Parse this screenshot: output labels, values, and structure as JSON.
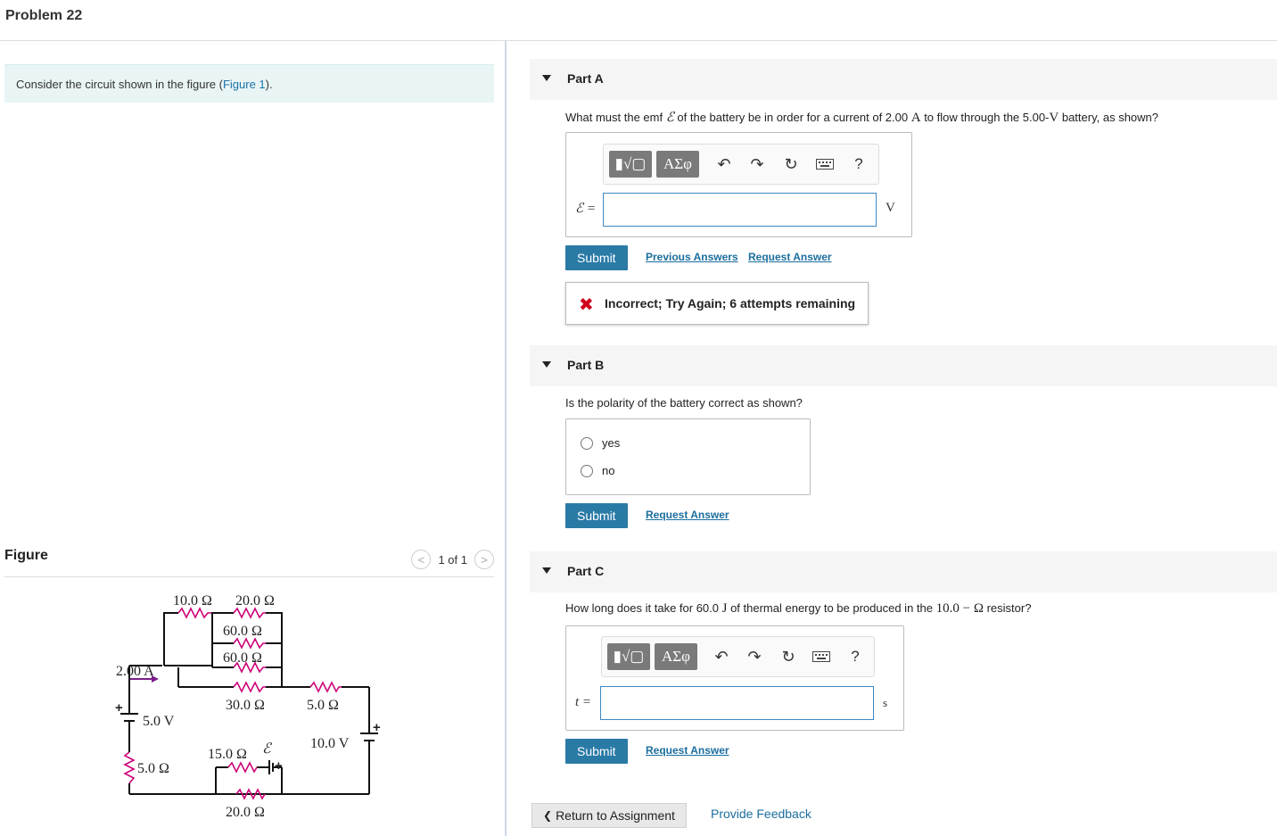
{
  "header": {
    "title": "Problem 22"
  },
  "intro": {
    "text_before": "Consider the circuit shown in the figure (",
    "figure_link": "Figure 1",
    "text_after": ")."
  },
  "figure_panel": {
    "label": "Figure",
    "pager_text": "1 of 1",
    "prev_glyph": "<",
    "next_glyph": ">",
    "circuit_labels": {
      "r10": "10.0 Ω",
      "r20top": "20.0 Ω",
      "r60a": "60.0 Ω",
      "r60b": "60.0 Ω",
      "current": "2.00 A",
      "r30": "30.0 Ω",
      "r5right": "5.0 Ω",
      "v5": "5.0 V",
      "v10": "10.0 V",
      "r15": "15.0 Ω",
      "emf": "ℰ",
      "r5left": "5.0 Ω",
      "r20bottom": "20.0 Ω",
      "plus": "+"
    }
  },
  "partA": {
    "title": "Part A",
    "q1": "What must the emf ",
    "q_emf": "ℰ",
    "q2": " of the battery be in order for a current of 2.00 ",
    "q_A": "A",
    "q3": " to flow through the 5.00-",
    "q_V": "V",
    "q4": " battery, as shown?",
    "toolbar": {
      "templates": "▮√▢",
      "greek": "ΑΣφ",
      "help": "?"
    },
    "var_label": "ℰ =",
    "input_value": "",
    "unit": "V",
    "submit": "Submit",
    "previous_answers": "Previous Answers",
    "request_answer": "Request Answer",
    "feedback_icon": "✖",
    "feedback_text": "Incorrect; Try Again; 6 attempts remaining"
  },
  "partB": {
    "title": "Part B",
    "question": "Is the polarity of the battery correct as shown?",
    "options": [
      "yes",
      "no"
    ],
    "submit": "Submit",
    "request_answer": "Request Answer"
  },
  "partC": {
    "title": "Part C",
    "q1": "How long does it take for 60.0 ",
    "q_J": "J",
    "q2": " of thermal energy to be produced in the ",
    "q_R": "10.0 − Ω",
    "q3": " resistor?",
    "toolbar": {
      "templates": "▮√▢",
      "greek": "ΑΣφ",
      "help": "?"
    },
    "var_label": "t =",
    "input_value": "",
    "unit": "s",
    "submit": "Submit",
    "request_answer": "Request Answer"
  },
  "footer": {
    "return": "Return to Assignment",
    "return_glyph": "❮",
    "provide_feedback": "Provide Feedback"
  },
  "colors": {
    "accent": "#2a7aa6",
    "link": "#1b6e9e",
    "resistor": "#cc0077",
    "current_arrow": "#7a1f8a",
    "error": "#d0021b",
    "intro_bg": "#e9f5f5"
  }
}
